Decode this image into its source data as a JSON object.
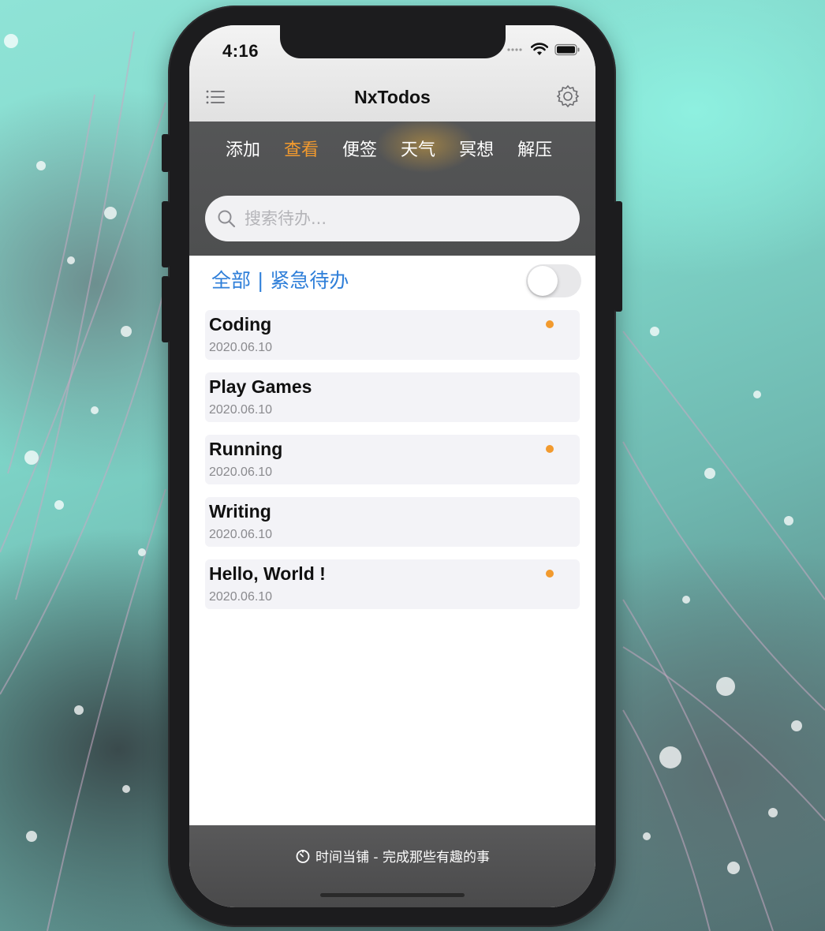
{
  "status_bar": {
    "time": "4:16",
    "icons": [
      "signal-dots-icon",
      "wifi-icon",
      "battery-icon"
    ]
  },
  "navbar": {
    "title": "NxTodos",
    "left_icon": "menu-list-icon",
    "right_icon": "settings-gear-icon"
  },
  "tabs": [
    {
      "label": "添加",
      "active": false
    },
    {
      "label": "查看",
      "active": true
    },
    {
      "label": "便签",
      "active": false
    },
    {
      "label": "天气",
      "active": false
    },
    {
      "label": "冥想",
      "active": false
    },
    {
      "label": "解压",
      "active": false
    }
  ],
  "search": {
    "placeholder": "搜索待办...",
    "value": ""
  },
  "filter": {
    "label": "全部 | 紧急待办",
    "urgent_only": false
  },
  "todos": [
    {
      "title": "Coding",
      "date": "2020.06.10",
      "urgent": true
    },
    {
      "title": "Play Games",
      "date": "2020.06.10",
      "urgent": false
    },
    {
      "title": "Running",
      "date": "2020.06.10",
      "urgent": true
    },
    {
      "title": "Writing",
      "date": "2020.06.10",
      "urgent": false
    },
    {
      "title": "Hello, World !",
      "date": "2020.06.10",
      "urgent": true
    }
  ],
  "footer": {
    "icon": "timer-icon",
    "text": "时间当铺 - 完成那些有趣的事"
  },
  "colors": {
    "accent": "#f29a2e",
    "link_blue": "#2f7fd9",
    "urgent_dot": "#f29a2e",
    "banner_bg": "#555657"
  }
}
